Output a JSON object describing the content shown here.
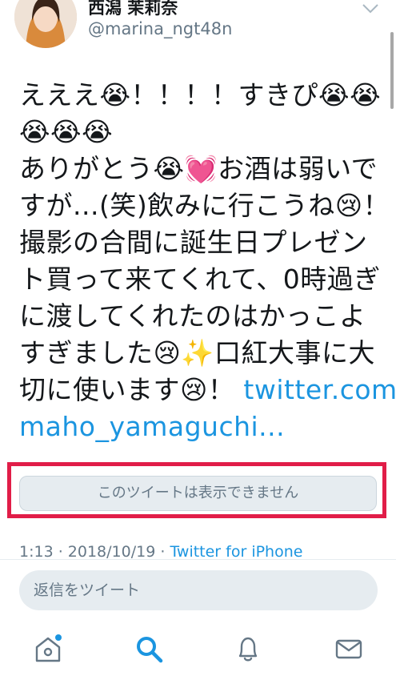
{
  "user": {
    "display_name": "西潟 茉莉奈",
    "handle": "@marina_ngt48n"
  },
  "tweet": {
    "lines": [
      "えええ😭！！！！すきぴ😭😭",
      "😭😭😭",
      "ありがとう😭💓お酒は弱いで",
      "すが...(笑)飲みに行こうね😢！",
      "撮影の合間に誕生日プレゼン",
      "ト買って来てくれて、0時過ぎ",
      "に渡してくれたのはかっこよ",
      "すぎました😢✨口紅大事に大"
    ],
    "line9_text": "切に使います😢！",
    "link_part1": "twitter.com/",
    "link_part2": "maho_yamaguchi..."
  },
  "quoted": {
    "unavailable_text": "このツイートは表示できません"
  },
  "meta": {
    "time": "1:13",
    "separator1": " · ",
    "date": "2018/10/19",
    "separator2": " · ",
    "source": "Twitter for iPhone"
  },
  "reply": {
    "placeholder": "返信をツイート"
  },
  "nav": {
    "home_icon": "home-icon",
    "search_icon": "search-icon",
    "notifications_icon": "bell-icon",
    "messages_icon": "envelope-icon",
    "active": "search"
  },
  "colors": {
    "accent": "#1b95e0",
    "text": "#14171a",
    "secondary": "#657786",
    "highlight": "#e11d48",
    "card_bg": "#e6ecf0"
  }
}
